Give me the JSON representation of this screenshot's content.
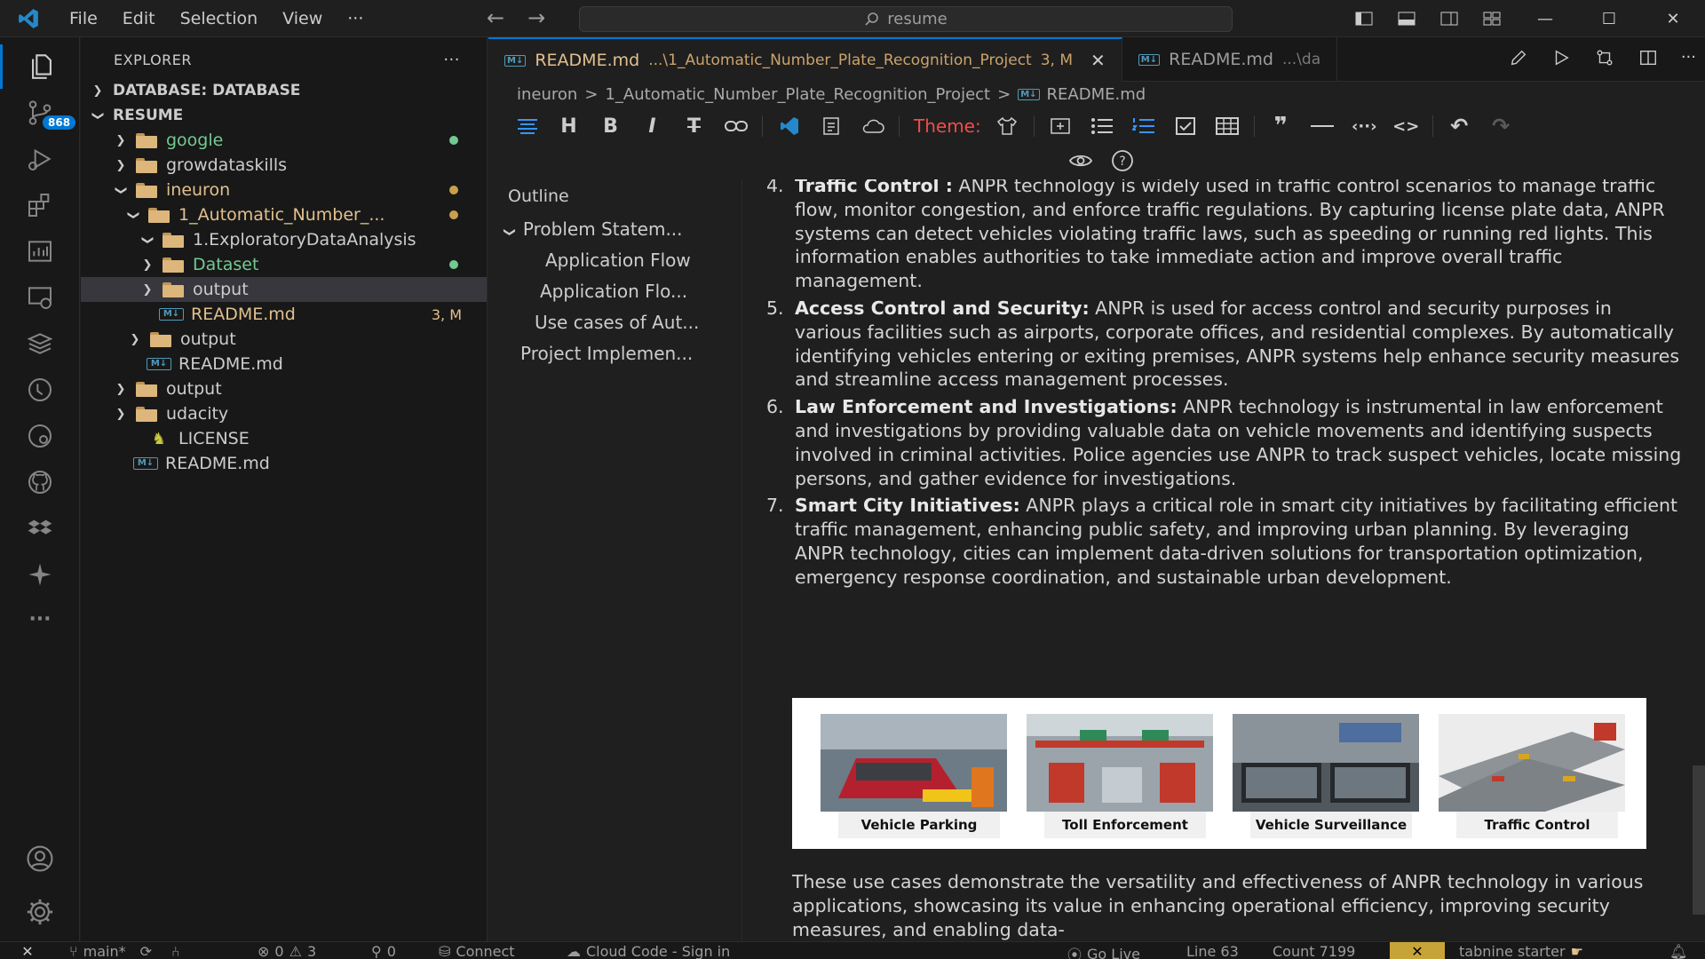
{
  "titlebar": {
    "menu": [
      "File",
      "Edit",
      "Selection",
      "View",
      "···"
    ],
    "search": "resume"
  },
  "activitybar": {
    "scm_badge": "868"
  },
  "sidebar": {
    "title": "EXPLORER",
    "more": "···",
    "sections": {
      "database": "DATABASE: DATABASE",
      "resume": "RESUME"
    },
    "tree": [
      {
        "label": "google"
      },
      {
        "label": "growdataskills"
      },
      {
        "label": "ineuron"
      },
      {
        "label": "1_Automatic_Number_..."
      },
      {
        "label": "1.ExploratoryDataAnalysis"
      },
      {
        "label": "Dataset"
      },
      {
        "label": "output"
      },
      {
        "label": "README.md",
        "badge": "3, M"
      },
      {
        "label": "output"
      },
      {
        "label": "README.md"
      },
      {
        "label": "output"
      },
      {
        "label": "udacity"
      },
      {
        "label": "LICENSE"
      },
      {
        "label": "README.md"
      }
    ]
  },
  "tabs": [
    {
      "label": "README.md",
      "desc": "...\\1_Automatic_Number_Plate_Recognition_Project",
      "badge": "3, M"
    },
    {
      "label": "README.md",
      "desc": "...\\da"
    }
  ],
  "breadcrumb": [
    "ineuron",
    "1_Automatic_Number_Plate_Recognition_Project",
    "README.md"
  ],
  "toolbar": {
    "theme_label": "Theme:"
  },
  "outline": {
    "title": "Outline",
    "items": [
      "Problem Statem...",
      "Application Flow",
      "Application Flo...",
      "Use cases of Aut...",
      "Project Implemen..."
    ]
  },
  "content": {
    "items": [
      {
        "num": "4.",
        "title": "Traffic Control :",
        "text": " ANPR technology is widely used in traffic control scenarios to manage traffic flow, monitor congestion, and enforce traffic regulations. By capturing license plate data, ANPR systems can detect vehicles violating traffic laws, such as speeding or running red lights. This information enables authorities to take immediate action and improve overall traffic management."
      },
      {
        "num": "5.",
        "title": "Access Control and Security:",
        "text": " ANPR is used for access control and security purposes in various facilities such as airports, corporate offices, and residential complexes. By automatically identifying vehicles entering or exiting premises, ANPR systems help enhance security measures and streamline access management processes."
      },
      {
        "num": "6.",
        "title": "Law Enforcement and Investigations:",
        "text": " ANPR technology is instrumental in law enforcement and investigations by providing valuable data on vehicle movements and identifying suspects involved in criminal activities. Police agencies use ANPR to track suspect vehicles, locate missing persons, and gather evidence for investigations."
      },
      {
        "num": "7.",
        "title": "Smart City Initiatives:",
        "text": " ANPR plays a critical role in smart city initiatives by facilitating efficient traffic management, enhancing public safety, and improving urban planning. By leveraging ANPR technology, cities can implement data-driven solutions for transportation optimization, emergency response coordination, and sustainable urban development."
      }
    ],
    "image_captions": [
      "Vehicle Parking",
      "Toll Enforcement",
      "Vehicle Surveillance",
      "Traffic Control"
    ],
    "closing_paragraph": "These use cases demonstrate the versatility and effectiveness of ANPR technology in various applications, showcasing its value in enhancing operational efficiency, improving security measures, and enabling data-"
  },
  "statusbar": {
    "branch": "main*",
    "errors": "0",
    "warnings": "3",
    "ports": "0",
    "connect": "Connect",
    "cloud": "Cloud Code - Sign in",
    "golive": "Go Live",
    "line": "Line 63",
    "count": "Count 7199",
    "tabnine": "tabnine starter"
  },
  "colors": {
    "accent": "#0078d4",
    "modified": "#e2c08d",
    "untracked": "#73c991",
    "theme_label": "#f14c4c"
  }
}
